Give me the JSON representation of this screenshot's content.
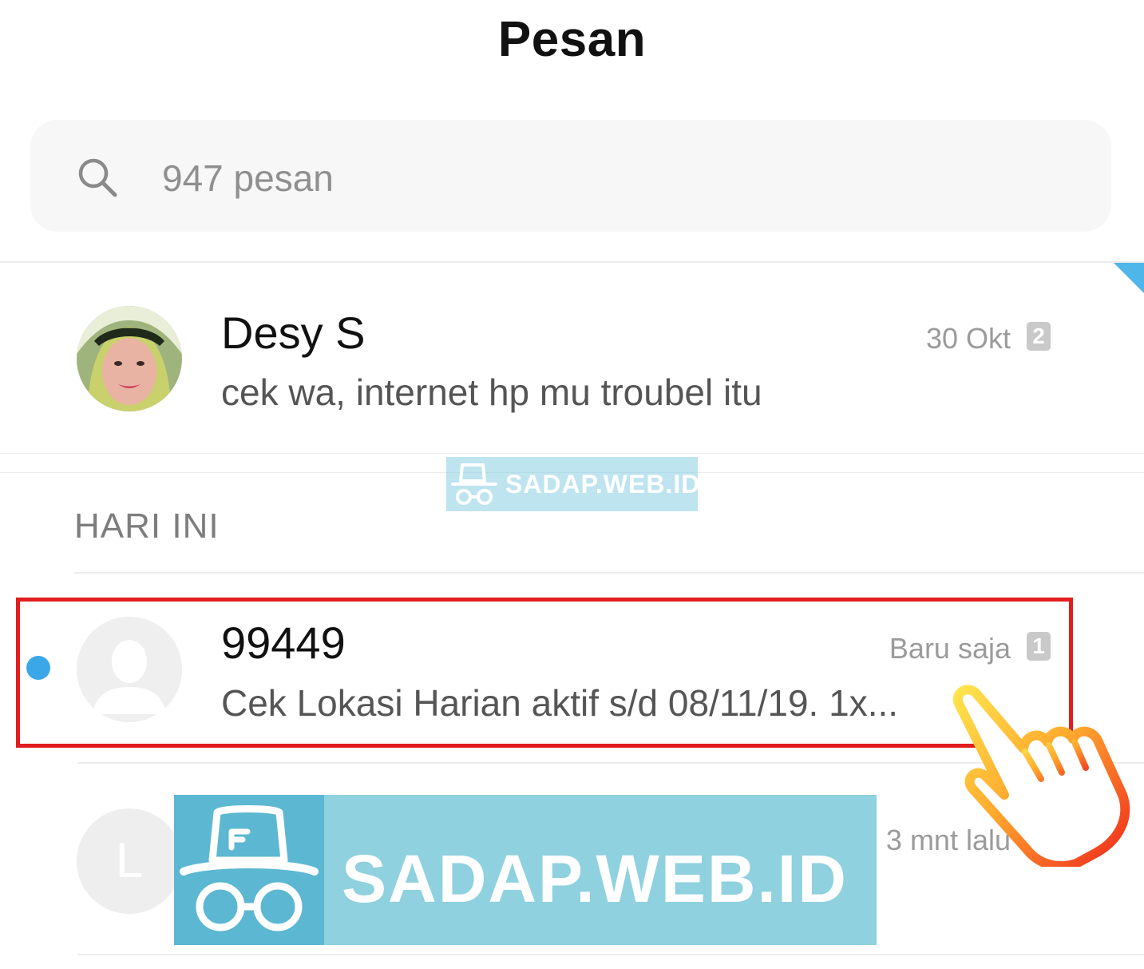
{
  "header": {
    "title": "Pesan"
  },
  "search": {
    "placeholder": "947 pesan"
  },
  "conversations": [
    {
      "name": "Desy S",
      "snippet": "cek wa, internet hp mu troubel itu",
      "time": "30 Okt",
      "count": "2",
      "pinned": true
    },
    {
      "name": "99449",
      "snippet": "Cek Lokasi Harian aktif s/d 08/11/19. 1x...",
      "time": "Baru saja",
      "count": "1",
      "unread": true,
      "highlighted": true
    },
    {
      "name": "",
      "avatar_letter": "L",
      "snippet": "",
      "time": "3 mnt lalu",
      "count": ""
    }
  ],
  "sections": {
    "today": "HARI INI"
  },
  "watermark": {
    "text": "SADAP.WEB.ID"
  },
  "colors": {
    "accent": "#3ba7e8",
    "highlight": "#e21d1d",
    "watermark": "#8fd1df",
    "watermark_dark": "#5cb7d2"
  }
}
